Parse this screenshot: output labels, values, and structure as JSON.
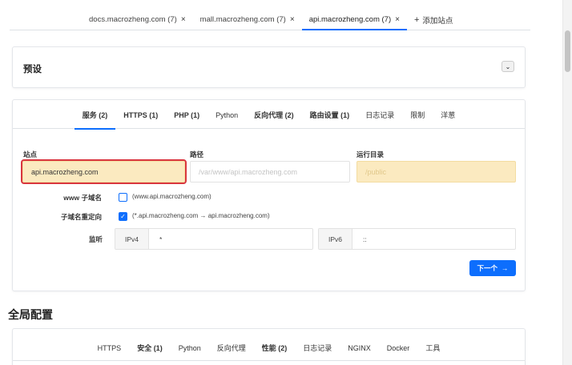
{
  "site_tabs": [
    {
      "label": "docs.macrozheng.com (7)",
      "close": "×",
      "active": false
    },
    {
      "label": "mall.macrozheng.com (7)",
      "close": "×",
      "active": false
    },
    {
      "label": "api.macrozheng.com (7)",
      "close": "×",
      "active": true
    }
  ],
  "add_site": {
    "icon": "+",
    "label": "添加站点"
  },
  "preset": {
    "title": "预设",
    "toggle_icon": "⌄"
  },
  "site_config_tabs": [
    {
      "label": "服务 (2)",
      "bold": true,
      "active": true
    },
    {
      "label": "HTTPS (1)",
      "bold": true,
      "active": false
    },
    {
      "label": "PHP (1)",
      "bold": true,
      "active": false
    },
    {
      "label": "Python",
      "bold": false,
      "active": false
    },
    {
      "label": "反向代理 (2)",
      "bold": true,
      "active": false
    },
    {
      "label": "路由设置 (1)",
      "bold": true,
      "active": false
    },
    {
      "label": "日志记录",
      "bold": false,
      "active": false
    },
    {
      "label": "限制",
      "bold": false,
      "active": false
    },
    {
      "label": "洋葱",
      "bold": false,
      "active": false
    }
  ],
  "fields": {
    "site": {
      "label": "站点",
      "value": "api.macrozheng.com"
    },
    "path": {
      "label": "路径",
      "placeholder": "/var/www/api.macrozheng.com"
    },
    "run_dir": {
      "label": "运行目录",
      "placeholder": "/public"
    }
  },
  "options": {
    "www_subdomain": {
      "label": "www 子域名",
      "hint": "(www.api.macrozheng.com)",
      "checked": false
    },
    "subdomain_redirect": {
      "label": "子域名重定向",
      "hint": "(*.api.macrozheng.com → api.macrozheng.com)",
      "checked": true,
      "check_icon": "✓"
    }
  },
  "listen": {
    "label": "监听",
    "ipv4": {
      "addon": "IPv4",
      "value": "*"
    },
    "ipv6": {
      "addon": "IPv6",
      "value": "::"
    }
  },
  "next_button": {
    "label": "下一个",
    "arrow": "→"
  },
  "global": {
    "title": "全局配置",
    "tabs": [
      {
        "label": "HTTPS",
        "bold": false,
        "active": false
      },
      {
        "label": "安全 (1)",
        "bold": true,
        "active": false
      },
      {
        "label": "Python",
        "bold": false,
        "active": false
      },
      {
        "label": "反向代理",
        "bold": false,
        "active": false
      },
      {
        "label": "性能 (2)",
        "bold": true,
        "active": false
      },
      {
        "label": "日志记录",
        "bold": false,
        "active": false
      },
      {
        "label": "NGINX",
        "bold": false,
        "active": false
      },
      {
        "label": "Docker",
        "bold": false,
        "active": false
      },
      {
        "label": "工具",
        "bold": false,
        "active": false
      }
    ]
  },
  "colors": {
    "accent": "#0d6efd",
    "highlight_border": "#d9363e",
    "yellow_field": "#fbeac0"
  }
}
